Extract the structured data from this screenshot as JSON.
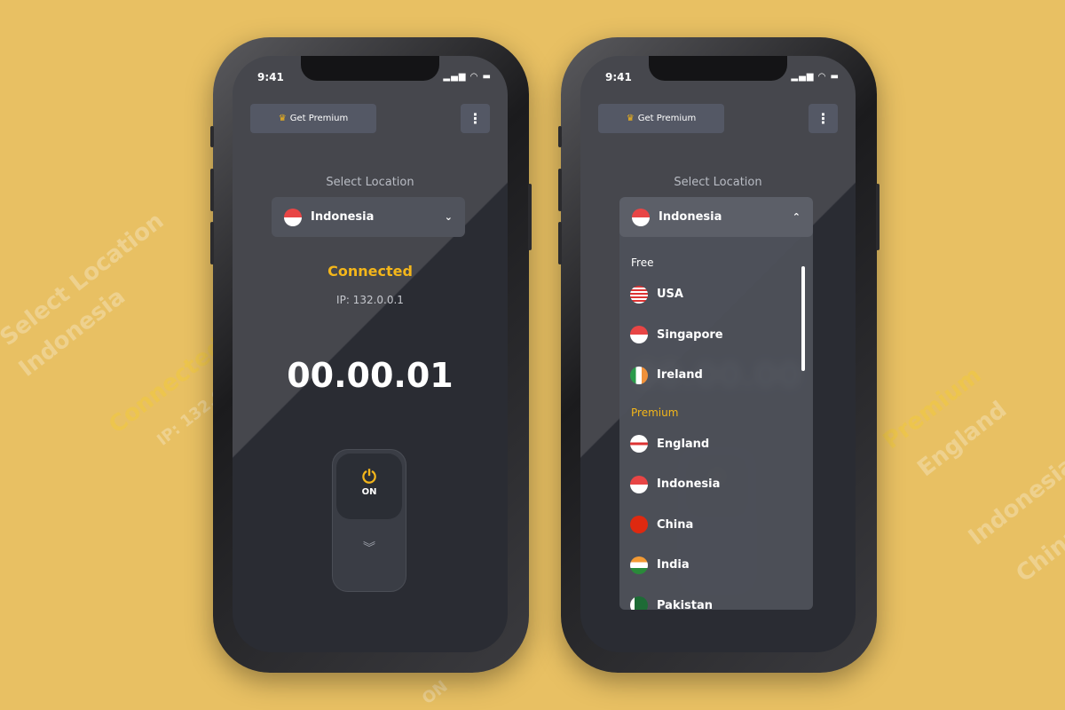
{
  "background_text": [
    "Select Location",
    "Indonesia",
    "Connected",
    "IP: 132.0",
    "Premium",
    "England",
    "Indonesia",
    "China",
    "ON"
  ],
  "colors": {
    "accent": "#f4b61a",
    "background": "#e8c063",
    "screen": "#2a2c33"
  },
  "phone1": {
    "time": "9:41",
    "premium_label": "Get Premium",
    "menu_icon": "more-vertical-icon",
    "select_label": "Select Location",
    "selected_country": "Indonesia",
    "status": "Connected",
    "ip": "IP: 132.0.0.1",
    "timer": "00.00.01",
    "toggle_label": "ON"
  },
  "phone2": {
    "time": "9:41",
    "premium_label": "Get Premium",
    "select_label": "Select Location",
    "selected_country": "Indonesia",
    "free_label": "Free",
    "premium_group_label": "Premium",
    "free": [
      {
        "name": "USA"
      },
      {
        "name": "Singapore"
      },
      {
        "name": "Ireland"
      }
    ],
    "premium": [
      {
        "name": "England"
      },
      {
        "name": "Indonesia"
      },
      {
        "name": "China"
      },
      {
        "name": "India"
      },
      {
        "name": "Pakistan"
      }
    ]
  }
}
